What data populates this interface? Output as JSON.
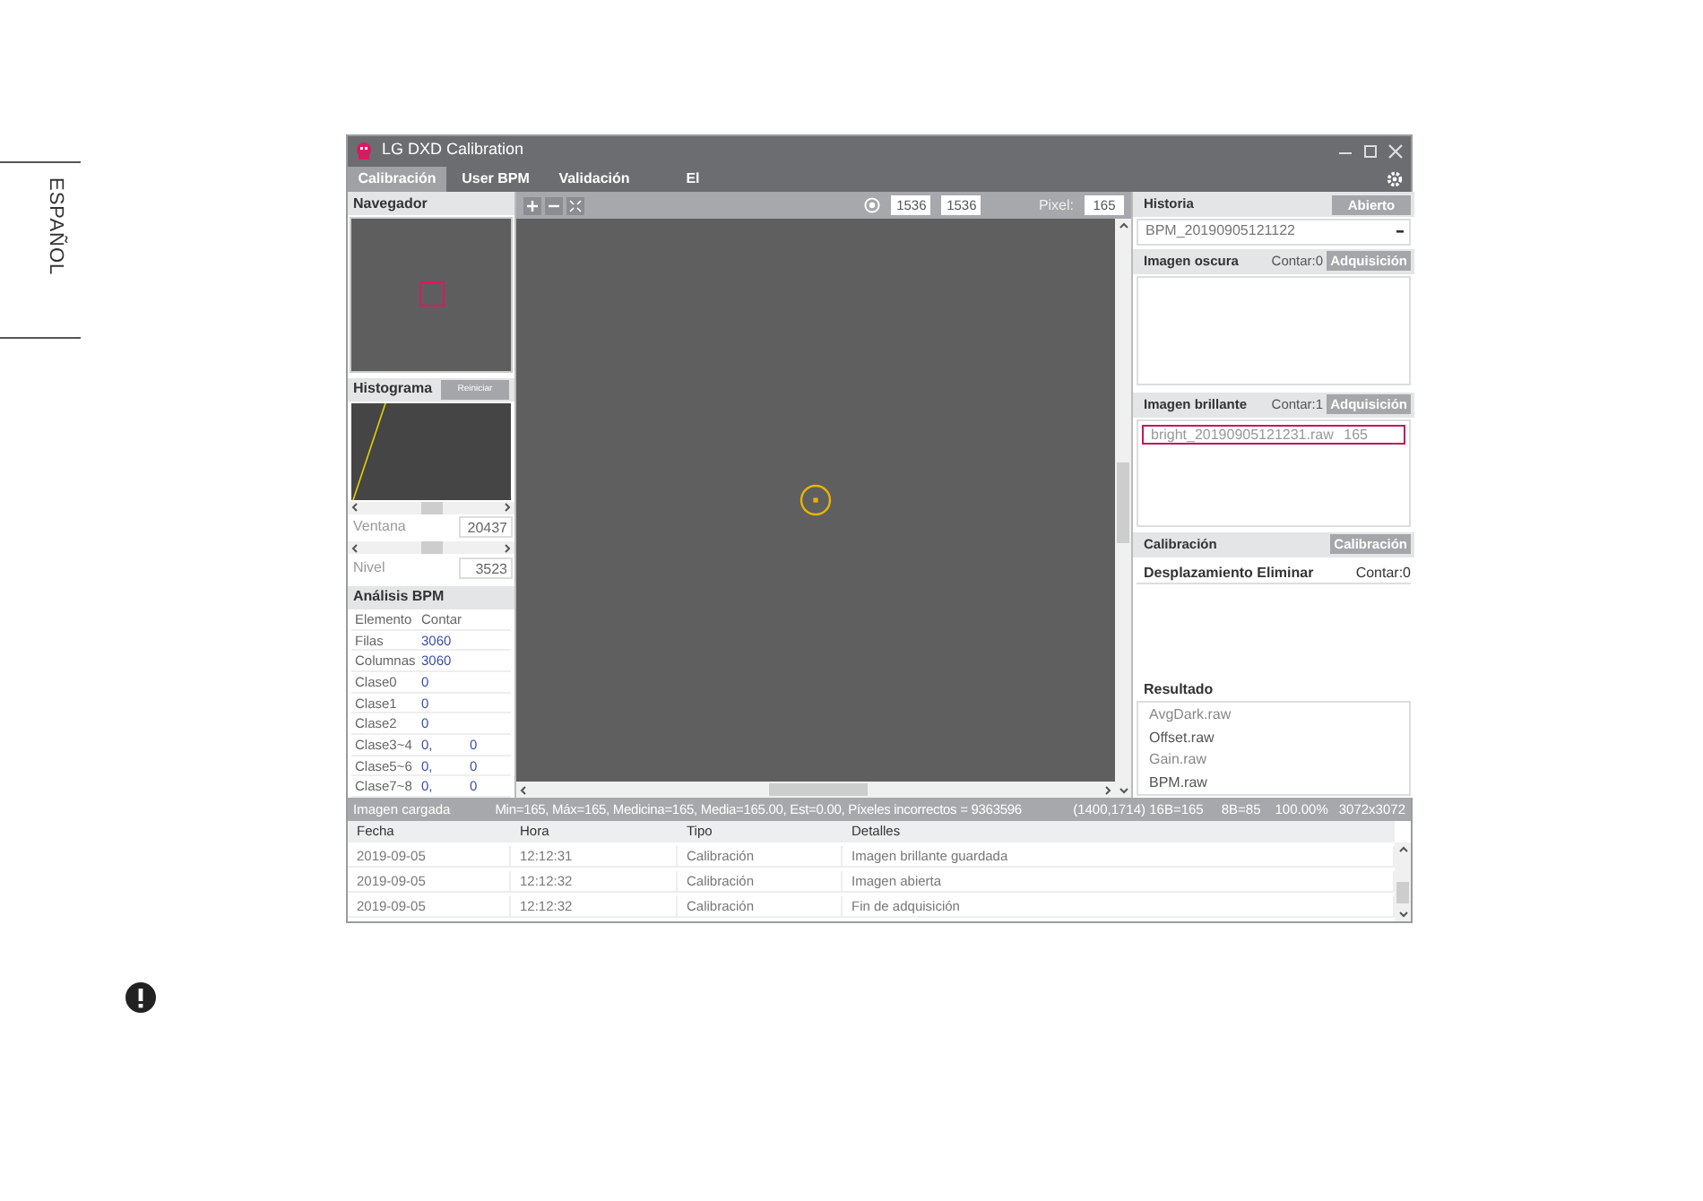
{
  "side_label": "ESPAÑOL",
  "window": {
    "title": "LG DXD Calibration"
  },
  "tabs": [
    {
      "label": "Calibración",
      "selected": true
    },
    {
      "label": "User BPM",
      "selected": false
    },
    {
      "label": "Validación",
      "selected": false
    },
    {
      "label": "El",
      "selected": false
    }
  ],
  "navigator": {
    "title": "Navegador"
  },
  "histogram": {
    "title": "Histograma",
    "reset_button": "Reiniciar",
    "fields": [
      {
        "label": "Ventana",
        "value": "20437"
      },
      {
        "label": "Nivel",
        "value": "3523"
      }
    ]
  },
  "bpm_analysis": {
    "title": "Análisis BPM",
    "columns": [
      "Elemento",
      "Contar"
    ],
    "rows": [
      [
        "Filas",
        "3060"
      ],
      [
        "Columnas",
        "3060"
      ],
      [
        "Clase0",
        "0"
      ],
      [
        "Clase1",
        "0"
      ],
      [
        "Clase2",
        "0"
      ],
      [
        "Clase3~4",
        "0,",
        "0"
      ],
      [
        "Clase5~6",
        "0,",
        "0"
      ],
      [
        "Clase7~8",
        "0,",
        "0"
      ]
    ]
  },
  "viewer_toolbar": {
    "x_value": "1536",
    "y_value": "1536",
    "pixel_label": "Pixel:",
    "pixel_value": "165"
  },
  "history": {
    "title": "Historia",
    "button": "Abierto",
    "selection": "BPM_20190905121122"
  },
  "dark_images": {
    "title": "Imagen oscura",
    "count": "Contar:0",
    "button": "Adquisición"
  },
  "bright_images": {
    "title": "Imagen brillante",
    "count": "Contar:1",
    "button": "Adquisición",
    "items": [
      {
        "name": "bright_20190905121231.raw",
        "value": "165",
        "selected": true
      }
    ]
  },
  "calibration": {
    "title": "Calibración",
    "button": "Calibración",
    "offset_title": "Desplazamiento Eliminar",
    "offset_count": "Contar:0",
    "result_title": "Resultado",
    "results": [
      "AvgDark.raw",
      "Offset.raw",
      "Gain.raw",
      "BPM.raw"
    ]
  },
  "status_bar": {
    "message": "Imagen cargada",
    "stats": "Min=165, Máx=165, Medicina=165, Media=165.00, Est=0.00, Píxeles incorrectos = 9363596",
    "position": "(1400,1714) 16B=165",
    "value_8b": "8B=85",
    "zoom": "100.00%",
    "size": "3072x3072"
  },
  "log": {
    "columns": [
      "Fecha",
      "Hora",
      "Tipo",
      "Detalles"
    ],
    "rows": [
      [
        "2019-09-05",
        "12:12:31",
        "Calibración",
        "Imagen brillante guardada"
      ],
      [
        "2019-09-05",
        "12:12:32",
        "Calibración",
        "Imagen abierta"
      ],
      [
        "2019-09-05",
        "12:12:32",
        "Calibración",
        "Fin de adquisición"
      ]
    ]
  }
}
